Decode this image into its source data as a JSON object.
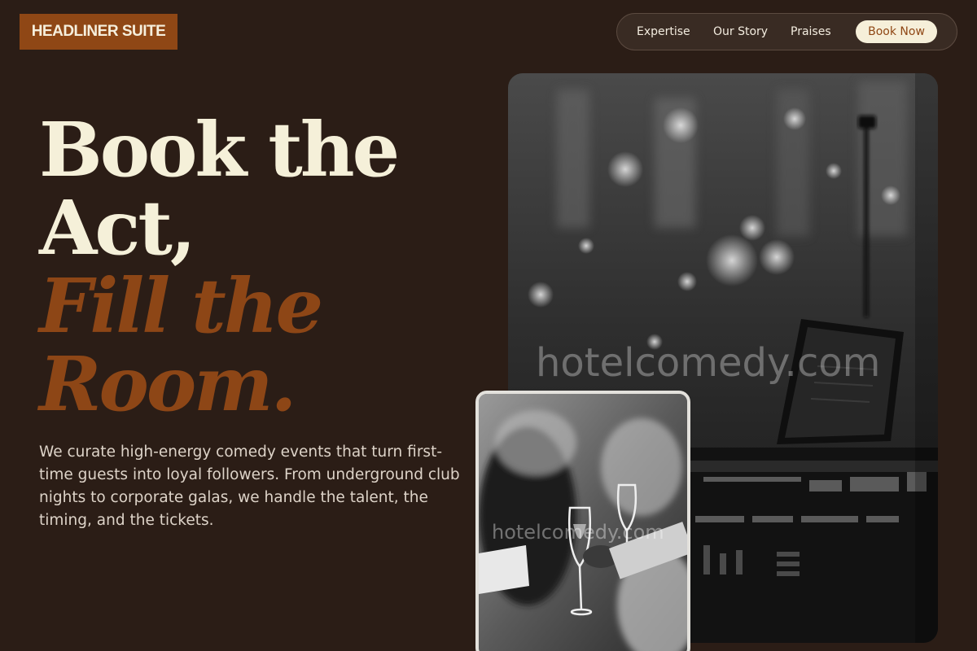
{
  "header": {
    "logo_text": "HEADLINER SUITE",
    "nav": {
      "items": [
        {
          "label": "Expertise"
        },
        {
          "label": "Our Story"
        },
        {
          "label": "Praises"
        }
      ],
      "cta_label": "Book Now"
    }
  },
  "hero": {
    "headline_lines": [
      "Book the",
      "Act,",
      "Fill the",
      "Room."
    ],
    "lead": "We curate high-energy comedy events that turn first-time guests into loyal followers. From underground club nights to corporate galas, we handle the talent, the timing, and the tickets."
  },
  "images": {
    "main_watermark": "hotelcomedy.com",
    "inset_watermark": "hotelcomedy.com"
  },
  "colors": {
    "background": "#2b1d16",
    "accent": "#8d4616",
    "cream": "#f5f0d9"
  }
}
